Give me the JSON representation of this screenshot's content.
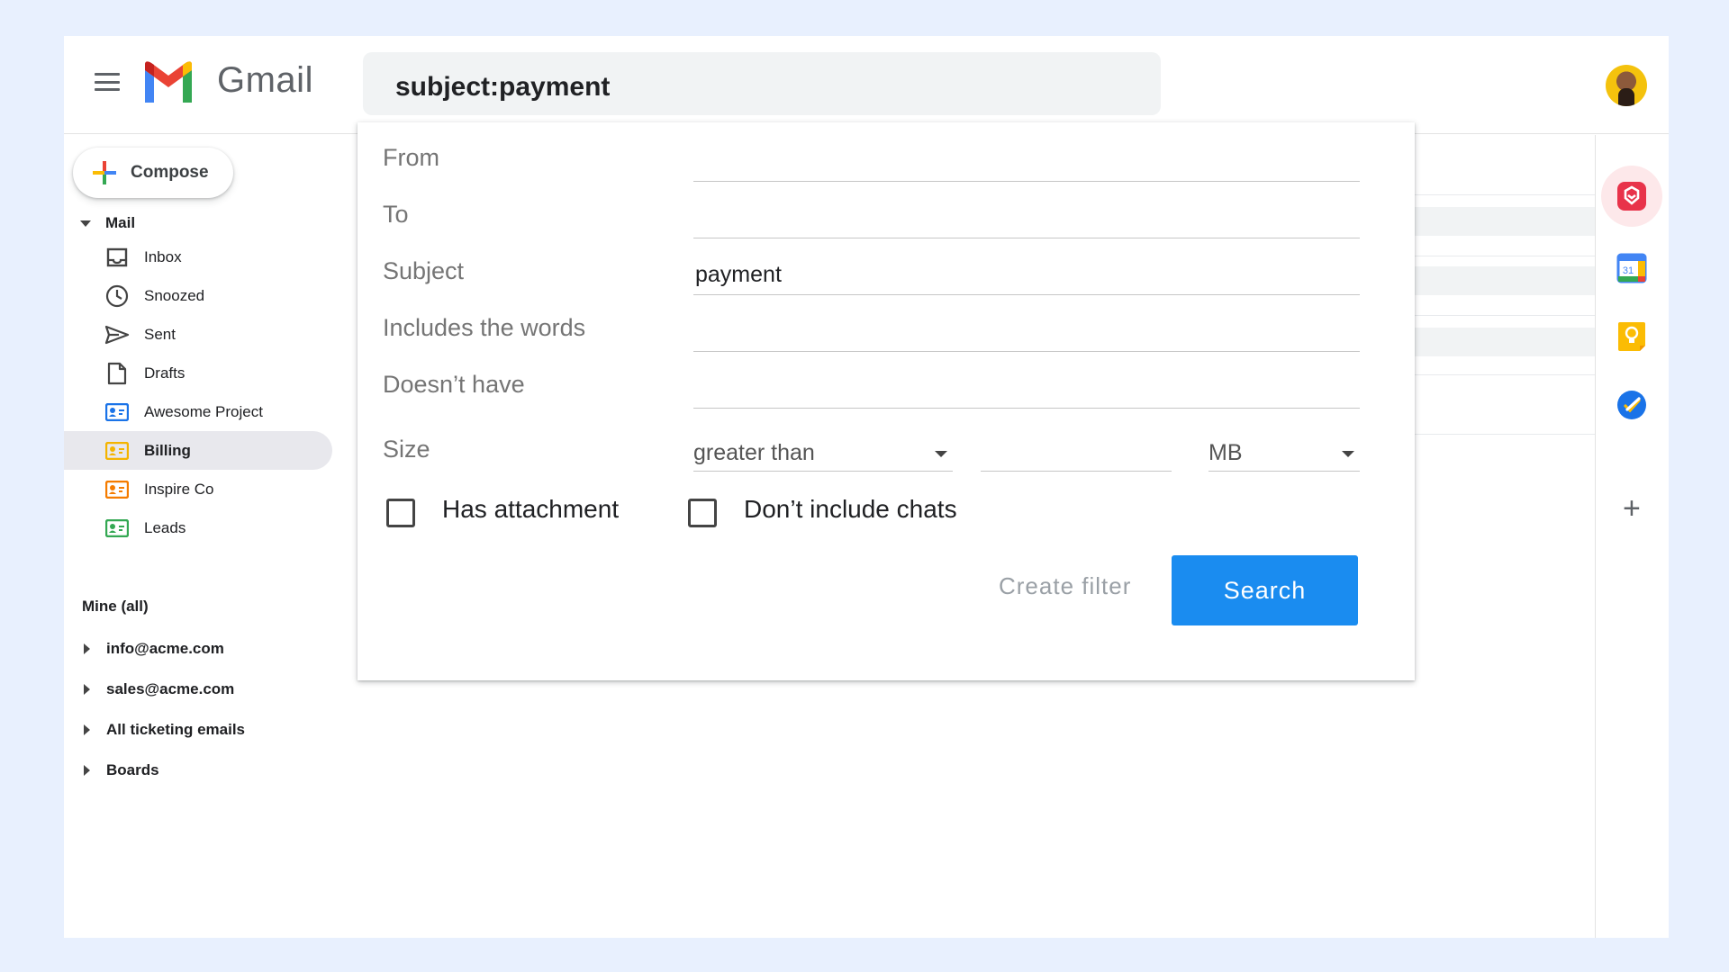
{
  "app": {
    "name": "Gmail",
    "search_query": "subject:payment"
  },
  "sidebar": {
    "compose_label": "Compose",
    "mail_section": "Mail",
    "items": [
      {
        "label": "Inbox",
        "icon": "inbox-icon"
      },
      {
        "label": "Snoozed",
        "icon": "clock-icon"
      },
      {
        "label": "Sent",
        "icon": "send-icon"
      },
      {
        "label": "Drafts",
        "icon": "draft-icon"
      },
      {
        "label": "Awesome Project",
        "icon": "label-icon",
        "color": "#1a73e8"
      },
      {
        "label": "Billing",
        "icon": "label-icon",
        "color": "#f4b400",
        "active": true
      },
      {
        "label": "Inspire Co",
        "icon": "label-icon",
        "color": "#f57c00"
      },
      {
        "label": "Leads",
        "icon": "label-icon",
        "color": "#34a853"
      }
    ],
    "mine_section": "Mine (all)",
    "accounts": [
      {
        "label": "info@acme.com"
      },
      {
        "label": "sales@acme.com"
      },
      {
        "label": "All ticketing emails"
      },
      {
        "label": "Boards"
      }
    ]
  },
  "search_panel": {
    "from_label": "From",
    "from_value": "",
    "to_label": "To",
    "to_value": "",
    "subject_label": "Subject",
    "subject_value": "payment",
    "includes_label": "Includes the words",
    "includes_value": "",
    "doesnt_have_label": "Doesn’t have",
    "doesnt_have_value": "",
    "size_label": "Size",
    "size_operator": "greater than",
    "size_value": "",
    "size_unit": "MB",
    "has_attachment_label": "Has attachment",
    "has_attachment_checked": false,
    "no_chats_label": "Don’t include chats",
    "no_chats_checked": false,
    "create_filter_label": "Create filter",
    "search_label": "Search"
  },
  "rightbar": {
    "apps": [
      {
        "icon": "addon-icon",
        "color": "#e8334a",
        "active": true
      },
      {
        "icon": "calendar-icon",
        "color": "#4285f4",
        "day": "31"
      },
      {
        "icon": "keep-icon",
        "color": "#fbbc04"
      },
      {
        "icon": "tasks-icon",
        "color": "#1a73e8"
      }
    ],
    "add_label": "+"
  },
  "colors": {
    "accent": "#1a8cf0",
    "background": "#e8f0fe"
  }
}
